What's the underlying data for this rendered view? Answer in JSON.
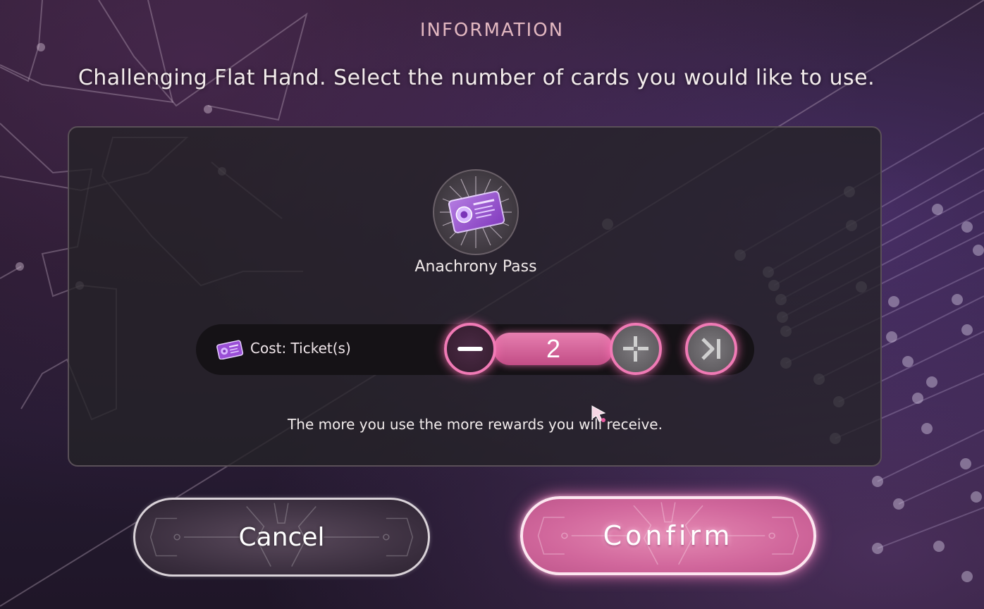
{
  "dialog": {
    "title": "INFORMATION",
    "message": "Challenging Flat Hand. Select the number of cards you would like to use."
  },
  "item": {
    "name": "Anachrony Pass",
    "icon": "anachrony-pass-card-icon"
  },
  "cost": {
    "label": "Cost: Ticket(s)",
    "icon": "ticket-card-icon",
    "quantity": "2"
  },
  "stepper": {
    "minus_icon": "minus-icon",
    "plus_icon": "plus-icon",
    "max_icon": "skip-to-max-icon"
  },
  "hint": "The more you use the more rewards you will receive.",
  "buttons": {
    "cancel_label": "Cancel",
    "confirm_label": "Confirm"
  },
  "colors": {
    "accent_pink": "#f07ab5",
    "title_text": "#e2b7c0",
    "panel_bg": "#242226"
  }
}
